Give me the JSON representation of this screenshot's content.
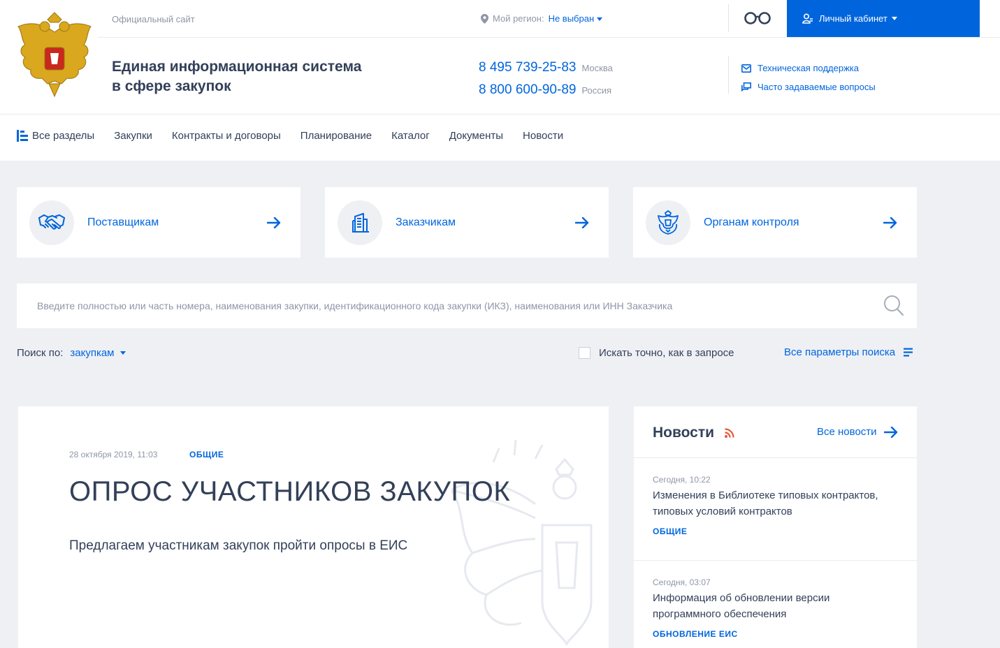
{
  "header": {
    "official_site": "Официальный сайт",
    "region_label": "Мой регион:",
    "region_value": "Не выбран",
    "cabinet_label": "Личный кабинет",
    "site_title_line1": "Единая информационная система",
    "site_title_line2": "в сфере закупок",
    "phones": [
      {
        "number": "8 495 739-25-83",
        "city": "Москва"
      },
      {
        "number": "8 800 600-90-89",
        "city": "Россия"
      }
    ],
    "support_label": "Техническая поддержка",
    "faq_label": "Часто задаваемые вопросы"
  },
  "nav": {
    "items": [
      "Все разделы",
      "Закупки",
      "Контракты и договоры",
      "Планирование",
      "Каталог",
      "Документы",
      "Новости"
    ]
  },
  "roles": [
    {
      "label": "Поставщикам",
      "icon": "handshake-icon"
    },
    {
      "label": "Заказчикам",
      "icon": "building-icon"
    },
    {
      "label": "Органам контроля",
      "icon": "emblem-icon"
    }
  ],
  "search": {
    "placeholder": "Введите полностью или часть номера, наименования закупки, идентификационного кода закупки (ИКЗ), наименования или ИНН Заказчика",
    "search_by_label": "Поиск по:",
    "search_by_value": "закупкам",
    "exact_label": "Искать точно, как в запросе",
    "all_params_label": "Все параметры поиска"
  },
  "feature": {
    "date": "28 октября 2019, 11:03",
    "tag": "ОБЩИЕ",
    "headline": "ОПРОС УЧАСТНИКОВ ЗАКУПОК",
    "lead": "Предлагаем участникам закупок пройти опросы в ЕИС"
  },
  "news": {
    "title": "Новости",
    "all_label": "Все новости",
    "items": [
      {
        "date": "Сегодня, 10:22",
        "text": "Изменения в Библиотеке типовых контрактов, типовых условий контрактов",
        "tag": "ОБЩИЕ"
      },
      {
        "date": "Сегодня, 03:07",
        "text": "Информация об обновлении версии программного обеспечения",
        "tag": "ОБНОВЛЕНИЕ ЕИС"
      }
    ]
  },
  "colors": {
    "accent": "#0065dd",
    "text": "#334059",
    "muted": "#8e96a6",
    "background": "#eef0f4",
    "rss": "#e8563a"
  }
}
